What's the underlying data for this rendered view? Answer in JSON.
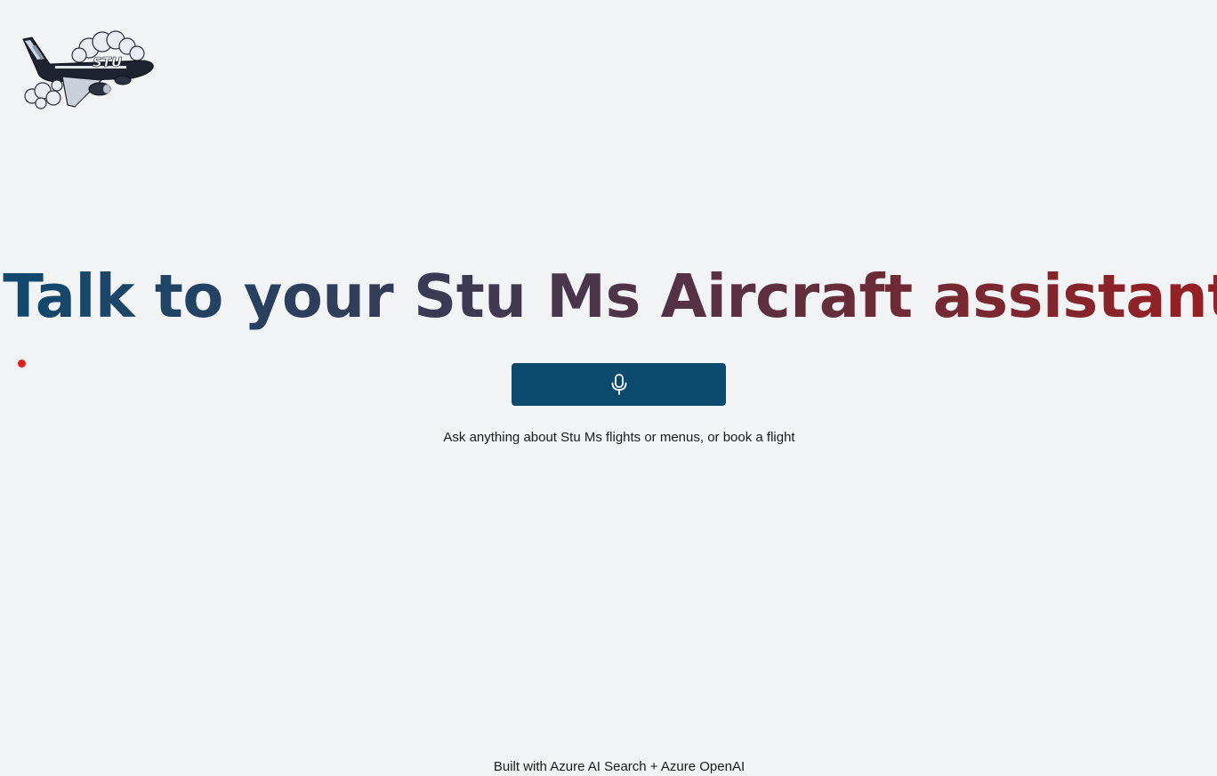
{
  "logo": {
    "icon": "airplane-logo-icon",
    "text": "STU"
  },
  "status": {
    "indicator_color": "#d8211f"
  },
  "main": {
    "title": "Talk to your Stu Ms Aircraft assistant",
    "title_gradient": [
      "#0f4a6e",
      "#3a3a55",
      "#5e2f3e",
      "#9a1f22"
    ],
    "mic_button": {
      "icon": "microphone-icon",
      "color": "#0b4a6c"
    },
    "hint": "Ask anything about Stu Ms flights or menus, or book a flight"
  },
  "footer": {
    "text": "Built with Azure AI Search + Azure OpenAI"
  }
}
